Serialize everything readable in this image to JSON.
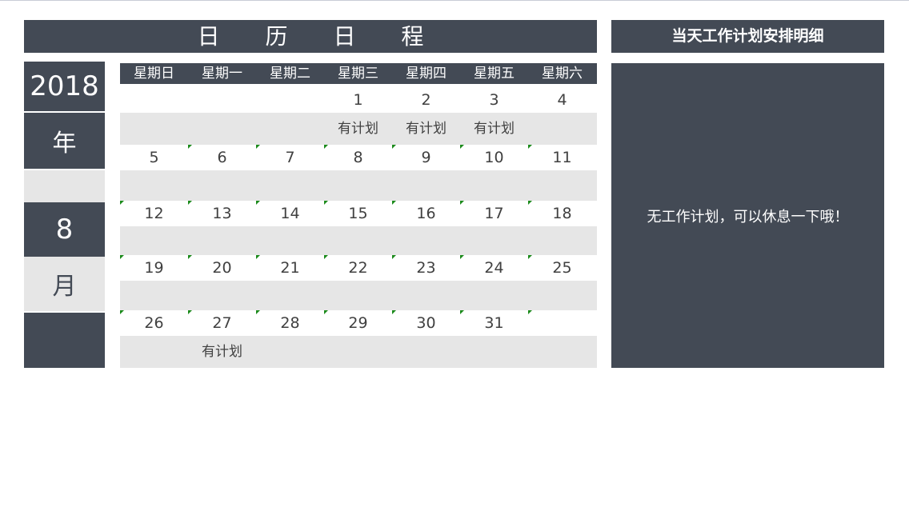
{
  "header": {
    "title": "日 历 日 程",
    "detail_title": "当天工作计划安排明细"
  },
  "left": {
    "year": "2018",
    "year_label": "年",
    "month": "8",
    "month_label": "月"
  },
  "weekdays": [
    "星期日",
    "星期一",
    "星期二",
    "星期三",
    "星期四",
    "星期五",
    "星期六"
  ],
  "weeks": [
    {
      "days": [
        "",
        "",
        "",
        "1",
        "2",
        "3",
        "4"
      ],
      "plans": [
        "",
        "",
        "",
        "有计划",
        "有计划",
        "有计划",
        ""
      ],
      "marked": [
        false,
        false,
        false,
        false,
        false,
        false,
        false
      ]
    },
    {
      "days": [
        "5",
        "6",
        "7",
        "8",
        "9",
        "10",
        "11"
      ],
      "plans": [
        "",
        "",
        "",
        "",
        "",
        "",
        ""
      ],
      "marked": [
        false,
        true,
        true,
        true,
        true,
        true,
        true
      ]
    },
    {
      "days": [
        "12",
        "13",
        "14",
        "15",
        "16",
        "17",
        "18"
      ],
      "plans": [
        "",
        "",
        "",
        "",
        "",
        "",
        ""
      ],
      "marked": [
        true,
        true,
        true,
        true,
        true,
        true,
        true
      ]
    },
    {
      "days": [
        "19",
        "20",
        "21",
        "22",
        "23",
        "24",
        "25"
      ],
      "plans": [
        "",
        "",
        "",
        "",
        "",
        "",
        ""
      ],
      "marked": [
        true,
        true,
        true,
        true,
        true,
        true,
        true
      ]
    },
    {
      "days": [
        "26",
        "27",
        "28",
        "29",
        "30",
        "31",
        ""
      ],
      "plans": [
        "",
        "有计划",
        "",
        "",
        "",
        "",
        ""
      ],
      "marked": [
        true,
        true,
        true,
        true,
        true,
        true,
        true
      ]
    }
  ],
  "detail": {
    "message": "无工作计划，可以休息一下哦！"
  },
  "colors": {
    "dark": "#434a55",
    "light_gray": "#e6e6e6",
    "marker_green": "#1a8a1a"
  }
}
